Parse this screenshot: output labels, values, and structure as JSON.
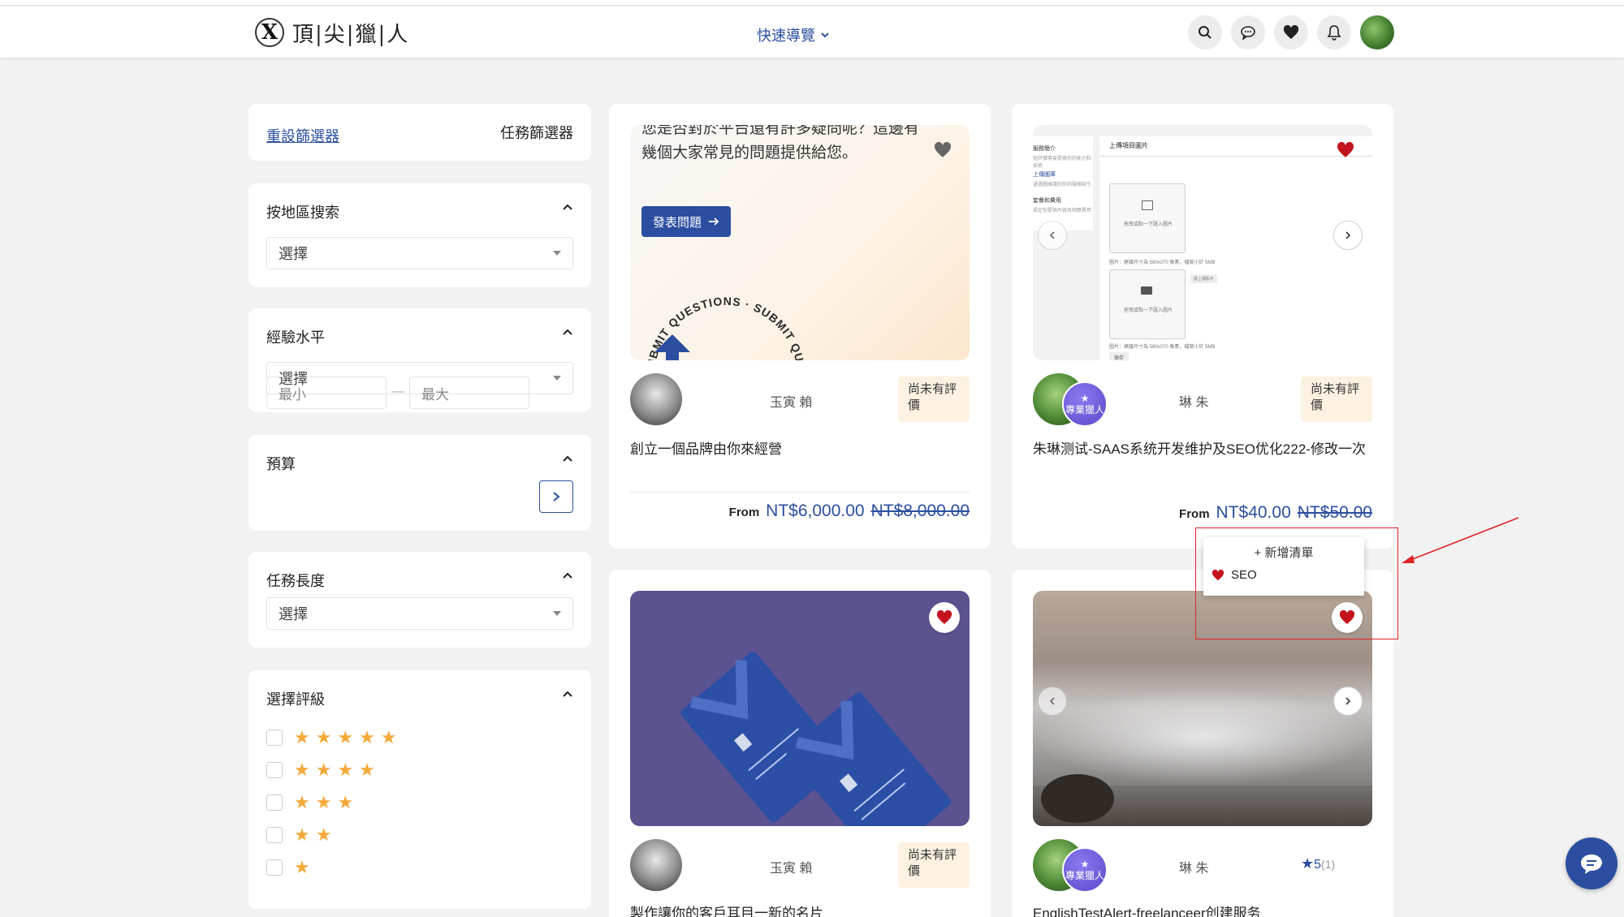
{
  "header": {
    "logo_mark": "X",
    "logo_text": "頂|尖|獵|人",
    "quick_nav": "快速導覽",
    "icons": [
      "search-icon",
      "chat-icon",
      "heart-icon",
      "bell-icon",
      "avatar"
    ]
  },
  "filters": {
    "reset": "重設篩選器",
    "title": "任務篩選器",
    "region": {
      "title": "按地區搜索",
      "value": "選擇"
    },
    "experience": {
      "title": "經驗水平",
      "value": "選擇"
    },
    "budget": {
      "title": "預算",
      "min_placeholder": "最小",
      "max_placeholder": "最大",
      "dash": "—"
    },
    "duration": {
      "title": "任務長度",
      "value": "選擇"
    },
    "rating": {
      "title": "選擇評級",
      "rows": [
        "★★★★★",
        "★★★★",
        "★★★",
        "★★",
        "★"
      ]
    }
  },
  "cards": [
    {
      "banner_text_1": "您是否對於平台還有許多疑問呢？這邊有",
      "banner_text_2": "幾個大家常見的問題提供給您。",
      "banner_button": "發表問題",
      "banner_circle_text": "SUBMIT QUESTIONS · SUBMIT QUESTIONS ·",
      "seller": "玉寅 賴",
      "rating": "尚未有評價",
      "title": "創立一個品牌由你來經營",
      "from": "From",
      "price": "NT$6,000.00",
      "old_price": "NT$8,000.00"
    },
    {
      "screenshot_nav_1": "服務簡介",
      "screenshot_nav_1_sub": "短評價專頁提高你的能力和技術",
      "screenshot_nav_2": "上傳圖庫",
      "screenshot_nav_2_sub": "通過圖庫讓別你的服務吸引",
      "screenshot_nav_3": "套餐和費用",
      "screenshot_nav_3_sub": "設定你提供內容及相應費用",
      "screenshot_heading": "上傳項目圖片",
      "screenshot_upload_hint": "拖曳或點一下匯入圖片",
      "screenshot_caption": "圖片：建議尺寸為 580x370 像素，檔案小於 5MB",
      "screenshot_tooltip": "請上傳影片",
      "screenshot_btn": "保存",
      "seller": "琳 朱",
      "pro_badge": "專業獵人",
      "rating": "尚未有評價",
      "title": "朱琳测试-SAAS系统开发维护及SEO优化222-修改一次",
      "from": "From",
      "price": "NT$40.00",
      "old_price": "NT$50.00"
    },
    {
      "seller": "玉寅 賴",
      "rating": "尚未有評價",
      "title": "製作讓你的客戶耳目一新的名片"
    },
    {
      "seller": "琳 朱",
      "pro_badge": "專業獵人",
      "rating_value": "5",
      "rating_count": "(1)",
      "title": "EnglishTestAlert-freelanceer创建服务"
    }
  ],
  "wishlist_popup": {
    "add_label": "+ 新增清單",
    "items": [
      "SEO"
    ]
  },
  "colors": {
    "accent": "#2b4ea0",
    "heart": "#c3141d",
    "star": "#f4a93a",
    "annotation": "#e0232a"
  }
}
